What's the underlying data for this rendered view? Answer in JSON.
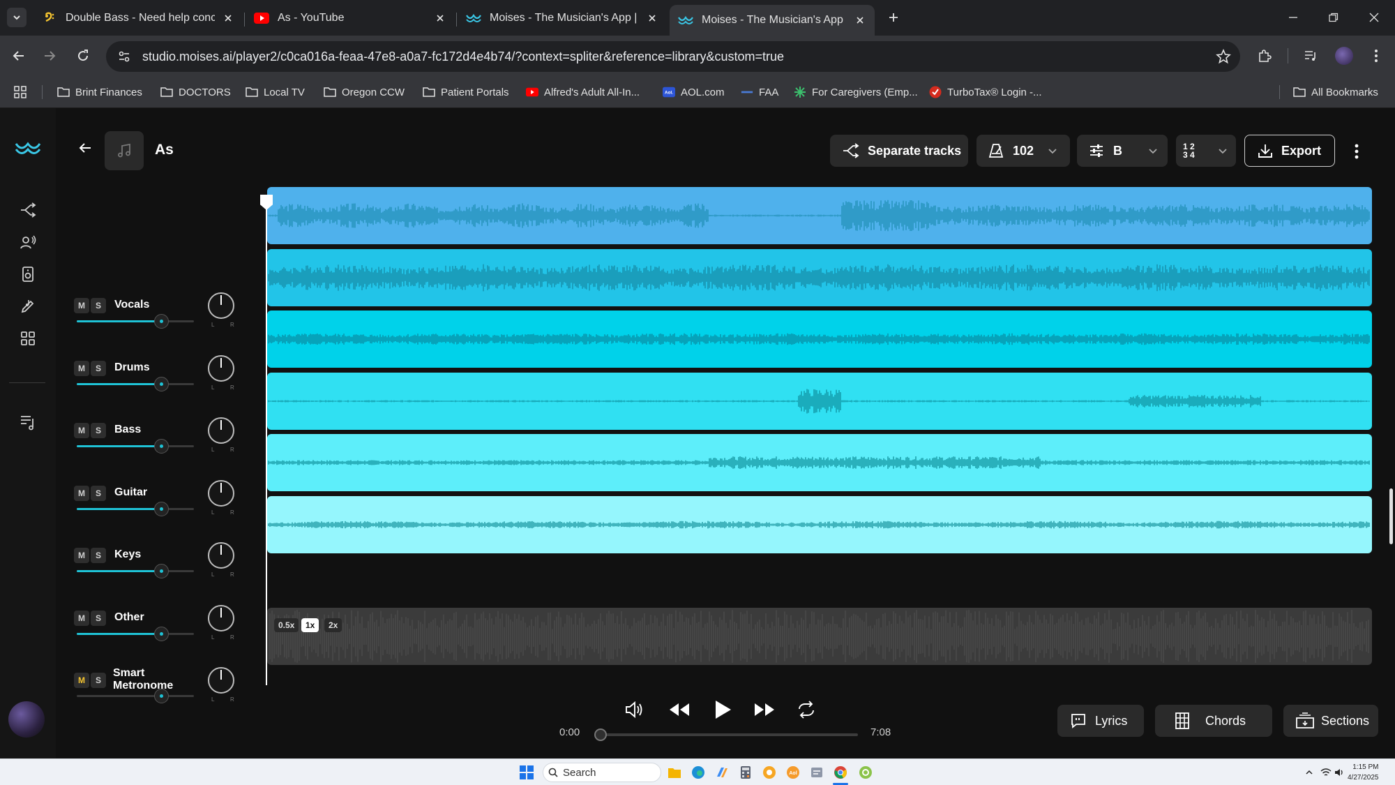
{
  "browser": {
    "tabs": [
      {
        "title": "Double Bass - Need help conce",
        "icon": "bass-clef-icon",
        "active": false
      },
      {
        "title": "As - YouTube",
        "icon": "youtube-icon",
        "active": false
      },
      {
        "title": "Moises - The Musician's App | F",
        "icon": "moises-icon",
        "active": false
      },
      {
        "title": "Moises - The Musician's App | F",
        "icon": "moises-icon",
        "active": true
      }
    ],
    "url": "studio.moises.ai/player2/c0ca016a-feaa-47e8-a0a7-fc172d4e4b74/?context=spliter&reference=library&custom=true",
    "bookmarks": [
      {
        "label": "Brint Finances",
        "icon": "folder-icon"
      },
      {
        "label": "DOCTORS",
        "icon": "folder-icon"
      },
      {
        "label": "Local TV",
        "icon": "folder-icon"
      },
      {
        "label": "Oregon CCW",
        "icon": "folder-icon"
      },
      {
        "label": "Patient Portals",
        "icon": "folder-icon"
      },
      {
        "label": "Alfred's Adult All-In...",
        "icon": "youtube-icon"
      },
      {
        "label": "AOL.com",
        "icon": "aol-icon"
      },
      {
        "label": "FAA",
        "icon": "faa-icon"
      },
      {
        "label": "For Caregivers (Emp...",
        "icon": "caregivers-icon"
      },
      {
        "label": "TurboTax® Login -...",
        "icon": "turbotax-icon"
      }
    ],
    "all_bookmarks": "All Bookmarks"
  },
  "player": {
    "song_title": "As",
    "separate_tracks_label": "Separate tracks",
    "bpm": "102",
    "key": "B",
    "time_signature_top": "1 2",
    "time_signature_bottom": "3 4",
    "export_label": "Export",
    "tracks": [
      {
        "name": "Vocals",
        "volume": 0.72,
        "color": "#4fb1ec",
        "wave": "#1f8fb5"
      },
      {
        "name": "Drums",
        "volume": 0.72,
        "color": "#22c4e8",
        "wave": "#168aa5"
      },
      {
        "name": "Bass",
        "volume": 0.72,
        "color": "#00d2ea",
        "wave": "#0a8aa0"
      },
      {
        "name": "Guitar",
        "volume": 0.72,
        "color": "#30e0f2",
        "wave": "#0e8f9e"
      },
      {
        "name": "Keys",
        "volume": 0.72,
        "color": "#5deefa",
        "wave": "#10909c"
      },
      {
        "name": "Other",
        "volume": 0.72,
        "color": "#95f6fd",
        "wave": "#13929b"
      }
    ],
    "metronome": {
      "name_line1": "Smart",
      "name_line2": "Metronome",
      "volume": 0.72,
      "speeds": [
        "0.5x",
        "1x",
        "2x"
      ],
      "selected_speed": "1x"
    },
    "mute_label": "M",
    "solo_label": "S",
    "pan_left": "L",
    "pan_right": "R",
    "transport": {
      "current_time": "0:00",
      "total_time": "7:08",
      "progress": 0
    },
    "features": {
      "lyrics": "Lyrics",
      "chords": "Chords",
      "sections": "Sections"
    }
  },
  "taskbar": {
    "search_placeholder": "Search",
    "time": "1:15 PM",
    "date": "4/27/2025"
  },
  "colors": {
    "accent": "#1fc3d6",
    "app_bg": "#111111",
    "chrome_bg": "#202124"
  }
}
